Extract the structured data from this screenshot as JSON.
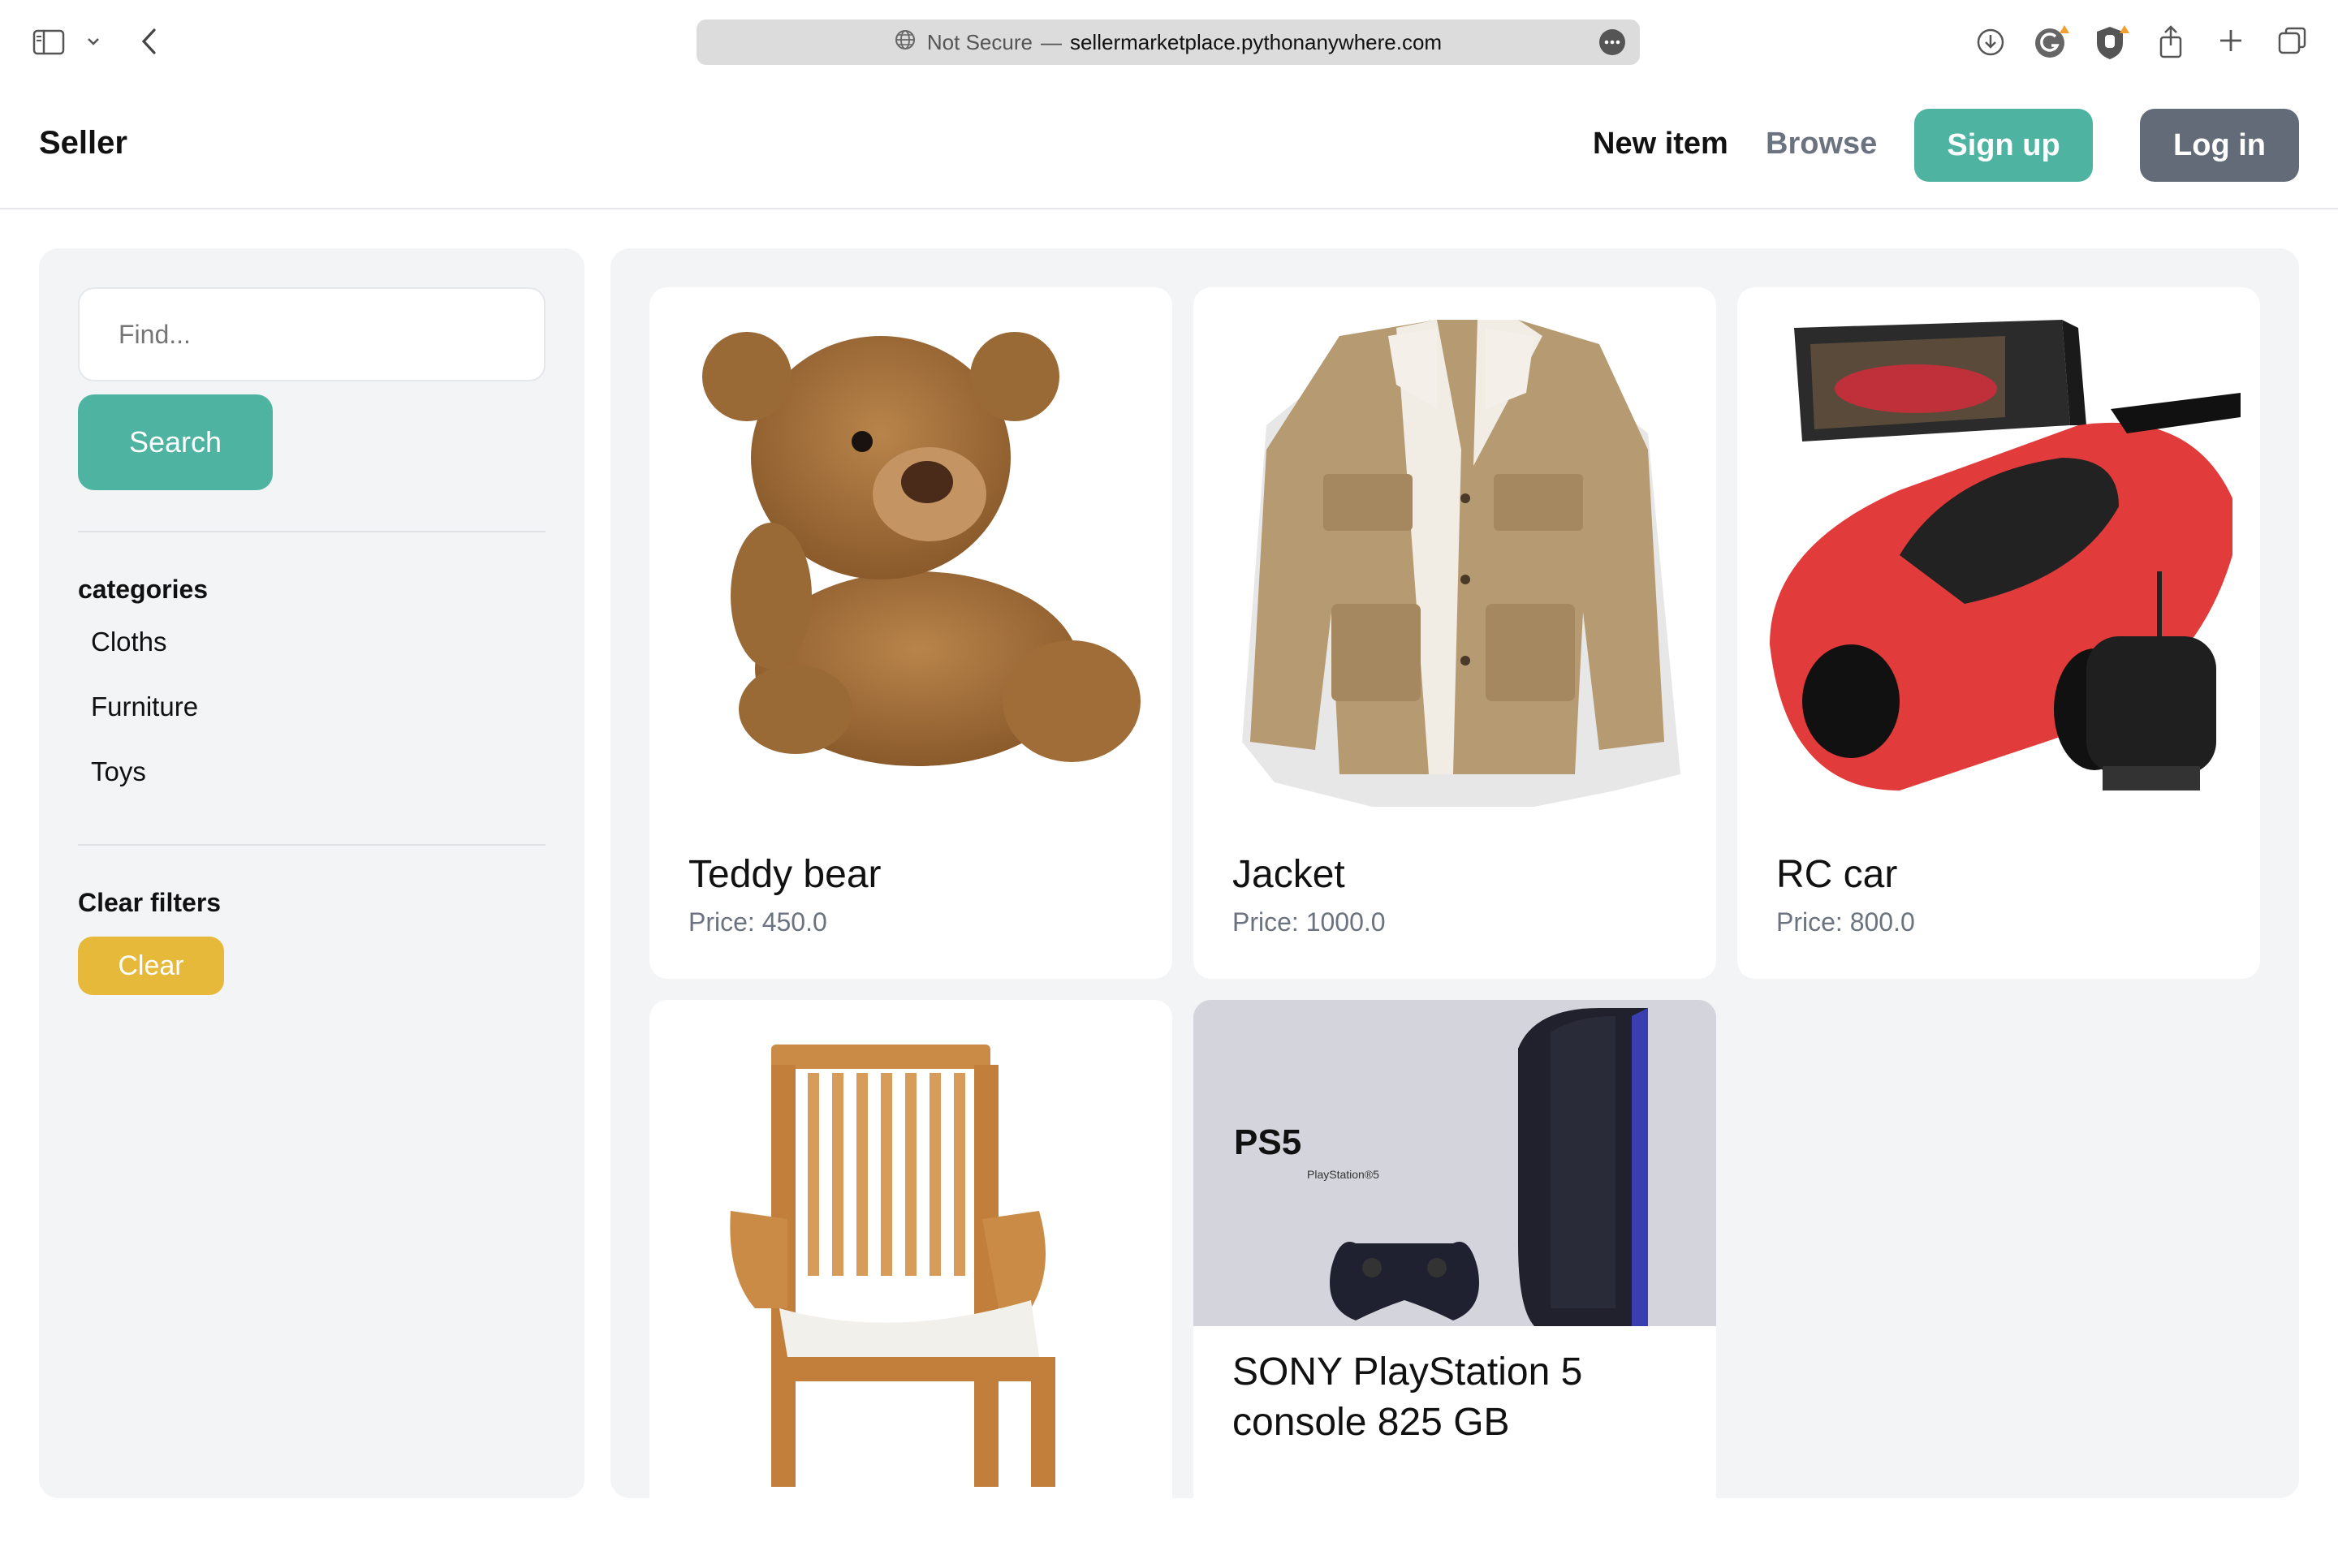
{
  "browser": {
    "url_prefix": "Not Secure",
    "url_sep": "—",
    "url_host": "sellermarketplace.pythonanywhere.com",
    "icons": [
      "sidebar-icon",
      "chevron-down-icon",
      "back-icon",
      "globe-icon",
      "more-icon",
      "download-icon",
      "grammarly-icon",
      "hand-icon",
      "share-icon",
      "plus-icon",
      "tabs-icon"
    ]
  },
  "header": {
    "brand": "Seller",
    "new_item": "New item",
    "browse": "Browse",
    "signup": "Sign up",
    "login": "Log in"
  },
  "sidebar": {
    "search_placeholder": "Find...",
    "search_button": "Search",
    "categories_title": "categories",
    "categories": [
      "Cloths",
      "Furniture",
      "Toys"
    ],
    "clear_title": "Clear filters",
    "clear_button": "Clear"
  },
  "items": [
    {
      "title": "Teddy bear",
      "price": "Price: 450.0",
      "image": "teddy-bear"
    },
    {
      "title": "Jacket",
      "price": "Price: 1000.0",
      "image": "jacket"
    },
    {
      "title": "RC car",
      "price": "Price: 800.0",
      "image": "rc-car"
    },
    {
      "title": "",
      "price": "",
      "image": "chair"
    },
    {
      "title": "SONY PlayStation 5 console 825 GB",
      "price": "",
      "image": "ps5",
      "logo_text": "PS5",
      "logo_sub": "PlayStation®5"
    }
  ],
  "colors": {
    "accent": "#4fb3a1",
    "login": "#646b78",
    "clear": "#e6b93a",
    "panel": "#f3f4f6"
  }
}
